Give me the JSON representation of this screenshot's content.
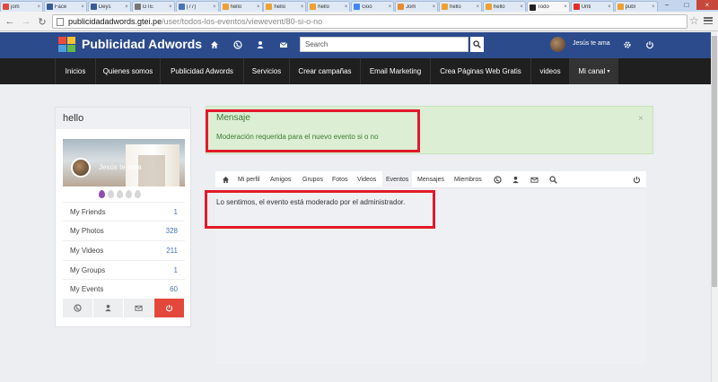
{
  "browser": {
    "tabs": [
      {
        "title": "jom",
        "color": "#e04a3f"
      },
      {
        "title": "Face",
        "color": "#3b5998"
      },
      {
        "title": "Deys",
        "color": "#3b5998"
      },
      {
        "title": "GTE",
        "color": "#777777"
      },
      {
        "title": "(77)",
        "color": "#4a73b8"
      },
      {
        "title": "hello",
        "color": "#f0a030"
      },
      {
        "title": "hello",
        "color": "#f0a030"
      },
      {
        "title": "hello",
        "color": "#f0a030"
      },
      {
        "title": "Goo",
        "color": "#4285f4"
      },
      {
        "title": "Jom",
        "color": "#e88b2e"
      },
      {
        "title": "hello",
        "color": "#f0a030"
      },
      {
        "title": "hello",
        "color": "#f0a030"
      },
      {
        "title": "Todo",
        "color": "#222222"
      },
      {
        "title": "Unti",
        "color": "#e52d27"
      },
      {
        "title": "publ",
        "color": "#f0a030"
      }
    ],
    "close_glyph": "×",
    "win_min": "−",
    "win_max": "□",
    "win_close": "×",
    "url_domain": "publicidadadwords.gtei.pe",
    "url_path": "/user/todos-los-eventos/viewevent/80-si-o-no"
  },
  "header": {
    "logo_text": "Publicidad Adwords",
    "search_placeholder": "Search",
    "user_name": "Jesús te ama",
    "logo_colors": [
      "#e94b3c",
      "#f6c231",
      "#4da0dd",
      "#62bb46"
    ]
  },
  "navbar": {
    "items": [
      "Inicios",
      "Quienes somos",
      "Publicidad Adwords",
      "Servicios",
      "Crear campañas",
      "Email Marketing",
      "Crea Páginas Web Gratis",
      "videos",
      "Mi canal"
    ],
    "caret": "▾"
  },
  "profile": {
    "title": "hello",
    "cover_name": "Jesús te ama",
    "stats": [
      {
        "label": "My Friends",
        "value": "1"
      },
      {
        "label": "My Photos",
        "value": "328"
      },
      {
        "label": "My Videos",
        "value": "211"
      },
      {
        "label": "My Groups",
        "value": "1"
      },
      {
        "label": "My Events",
        "value": "60"
      }
    ]
  },
  "message": {
    "title": "Mensaje",
    "body": "Moderación requerida para el nuevo evento si o no",
    "close": "×"
  },
  "subnav": {
    "items": [
      "Mi perfil",
      "Amigos",
      "Grupos",
      "Fotos",
      "Videos",
      "Eventos",
      "Mensajes",
      "Miembros"
    ],
    "active": "Eventos"
  },
  "content": {
    "notice": "Lo sentimos, el evento está moderado por el administrador."
  }
}
